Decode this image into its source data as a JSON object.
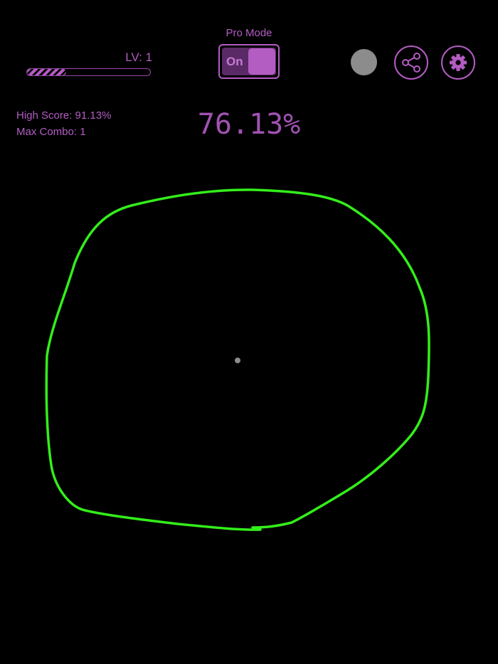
{
  "level": {
    "label": "LV: 1",
    "progress": 0.32
  },
  "pro_mode": {
    "label": "Pro Mode",
    "state_label": "On"
  },
  "stats": {
    "high_score": "High Score: 91.13%",
    "max_combo": "Max Combo: 1"
  },
  "score": "76.13%",
  "icons": {
    "color_picker": "color-dot-icon",
    "share": "share-icon",
    "settings": "gear-icon"
  },
  "colors": {
    "accent": "#b35cc2",
    "stroke": "#33ee1a",
    "background": "#000000",
    "color_dot": "#8c8c8c"
  }
}
